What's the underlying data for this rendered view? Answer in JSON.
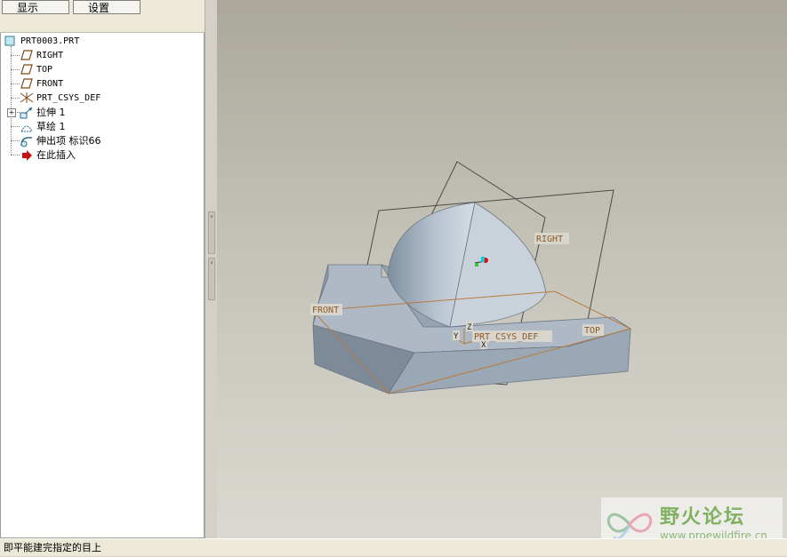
{
  "toolbar": {
    "show_label": "显示 (D)",
    "settings_label": "设置 (G)"
  },
  "tree": {
    "root": "PRT0003.PRT",
    "items": [
      {
        "label": "RIGHT",
        "icon": "datum-plane-icon"
      },
      {
        "label": "TOP",
        "icon": "datum-plane-icon"
      },
      {
        "label": "FRONT",
        "icon": "datum-plane-icon"
      },
      {
        "label": "PRT_CSYS_DEF",
        "icon": "coordinate-system-icon"
      },
      {
        "label": "拉伸 1",
        "icon": "extrude-icon"
      },
      {
        "label": "草绘 1",
        "icon": "sketch-icon"
      },
      {
        "label": "伸出项 标识66",
        "icon": "protrusion-icon"
      },
      {
        "label": "在此插入",
        "icon": "insert-here-arrow-icon"
      }
    ]
  },
  "viewport": {
    "labels": {
      "right": "RIGHT",
      "front": "FRONT",
      "top": "TOP",
      "csys": "PRT_CSYS_DEF",
      "z": "Z",
      "y": "Y",
      "x": "X"
    }
  },
  "status": {
    "message": "即平能建完指定的目上"
  },
  "watermark": {
    "title": "野火论坛",
    "url": "www.proewildfire.cn"
  },
  "colors": {
    "datum": "#8c5a2a",
    "model": "#a9b6c4",
    "background_top": "#aba89b",
    "background_bottom": "#dad9d1"
  }
}
